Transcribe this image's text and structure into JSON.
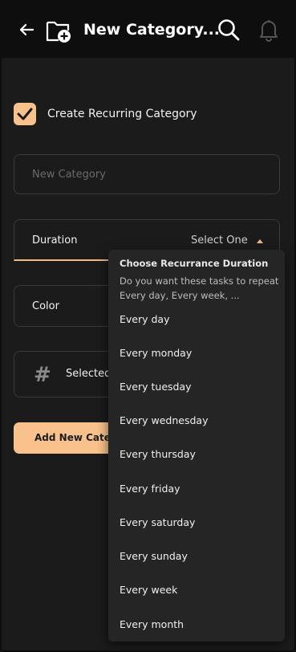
{
  "header": {
    "title": "New Category..."
  },
  "form": {
    "recurring_label": "Create Recurring Category",
    "recurring_checked": true,
    "name_placeholder": "New Category",
    "duration_label": "Duration",
    "duration_value": "Select One",
    "color_label": "Color",
    "icon_label": "Selected Icon",
    "icon_glyph": "#",
    "add_button": "Add New Category"
  },
  "dropdown": {
    "title": "Choose Recurrance Duration",
    "description": "Do you want these tasks to repeat Every day, Every week, ...",
    "options": [
      "Every day",
      "Every monday",
      "Every tuesday",
      "Every wednesday",
      "Every thursday",
      "Every friday",
      "Every saturday",
      "Every sunday",
      "Every week",
      "Every month"
    ]
  },
  "colors": {
    "accent": "#f9c28c",
    "background": "#1b1b1b",
    "header": "#0e0e0e",
    "dropdown": "#252525"
  }
}
